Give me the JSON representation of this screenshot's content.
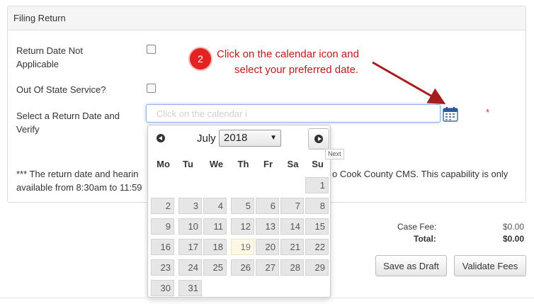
{
  "panel": {
    "title": "Filing Return"
  },
  "form": {
    "return_date_na_label_line1": "Return Date Not",
    "return_date_na_label_line2": "Applicable",
    "out_of_state_label": "Out Of State Service?",
    "select_date_label_line1": "Select a Return Date and",
    "select_date_label_line2": "Verify",
    "date_input_placeholder": "Click on the calendar i",
    "required_mark": "*",
    "notice_line1_start": "*** The return date and hearin",
    "notice_line1_end": "o Cook County CMS. This capability is only",
    "notice_line2_start": "available from 8:30am to 11:59"
  },
  "annotation": {
    "step_number": "2",
    "line1": "Click on the calendar icon and",
    "line2": "select your preferred date.",
    "color": "#c0191a"
  },
  "datepicker": {
    "month": "July",
    "year": "2018",
    "next_tooltip": "Next",
    "weekdays": [
      "Mo",
      "Tu",
      "We",
      "Th",
      "Fr",
      "Sa",
      "Su"
    ],
    "weeks": [
      [
        "",
        "",
        "",
        "",
        "",
        "",
        "1"
      ],
      [
        "2",
        "3",
        "4",
        "5",
        "6",
        "7",
        "8"
      ],
      [
        "9",
        "10",
        "11",
        "12",
        "13",
        "14",
        "15"
      ],
      [
        "16",
        "17",
        "18",
        "19",
        "20",
        "21",
        "22"
      ],
      [
        "23",
        "24",
        "25",
        "26",
        "27",
        "28",
        "29"
      ],
      [
        "30",
        "31",
        "",
        "",
        "",
        "",
        ""
      ]
    ],
    "highlighted_day": "19"
  },
  "fees": {
    "case_fee_label": "Case Fee:",
    "case_fee_value": "$0.00",
    "total_label": "Total:",
    "total_value": "$0.00"
  },
  "actions": {
    "save_draft_label": "Save as Draft",
    "validate_fees_label": "Validate Fees"
  }
}
